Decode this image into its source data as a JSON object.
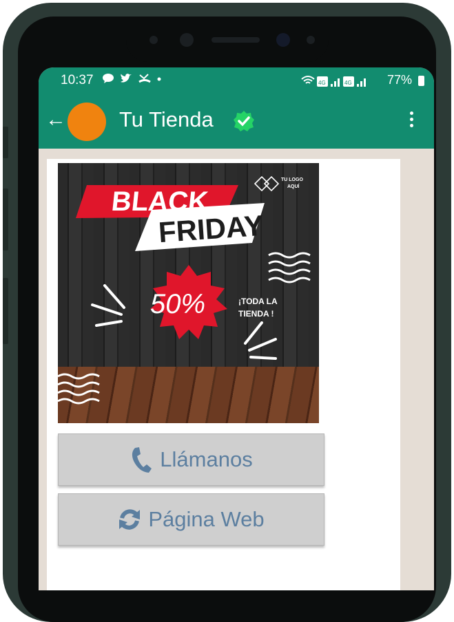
{
  "status_bar": {
    "time": "10:37",
    "left_icons": [
      "chat-bubble-icon",
      "twitter-icon",
      "missed-call-icon",
      "dot-icon"
    ],
    "right_icons": [
      "wifi-icon",
      "volte-4g-icon",
      "signal-1-icon",
      "volte-4g-icon",
      "signal-2-icon"
    ],
    "battery_percent": "77%"
  },
  "header": {
    "contact_name": "Tu Tienda",
    "verified": true,
    "color": "#128c6f",
    "avatar_color": "#f0830f"
  },
  "promo": {
    "line1": "BLACK",
    "line2": "FRIDAY",
    "logo_line1": "TU LOGO",
    "logo_line2": "AQUÍ",
    "discount": "50%",
    "tagline_line1": "¡TODA LA",
    "tagline_line2": "TIENDA !"
  },
  "buttons": [
    {
      "label": "Llámanos",
      "icon": "phone-icon"
    },
    {
      "label": "Página Web",
      "icon": "refresh-icon"
    }
  ],
  "colors": {
    "button_text": "#5c7fa0",
    "chat_background": "#e5ddd5",
    "promo_red": "#e0162b"
  }
}
